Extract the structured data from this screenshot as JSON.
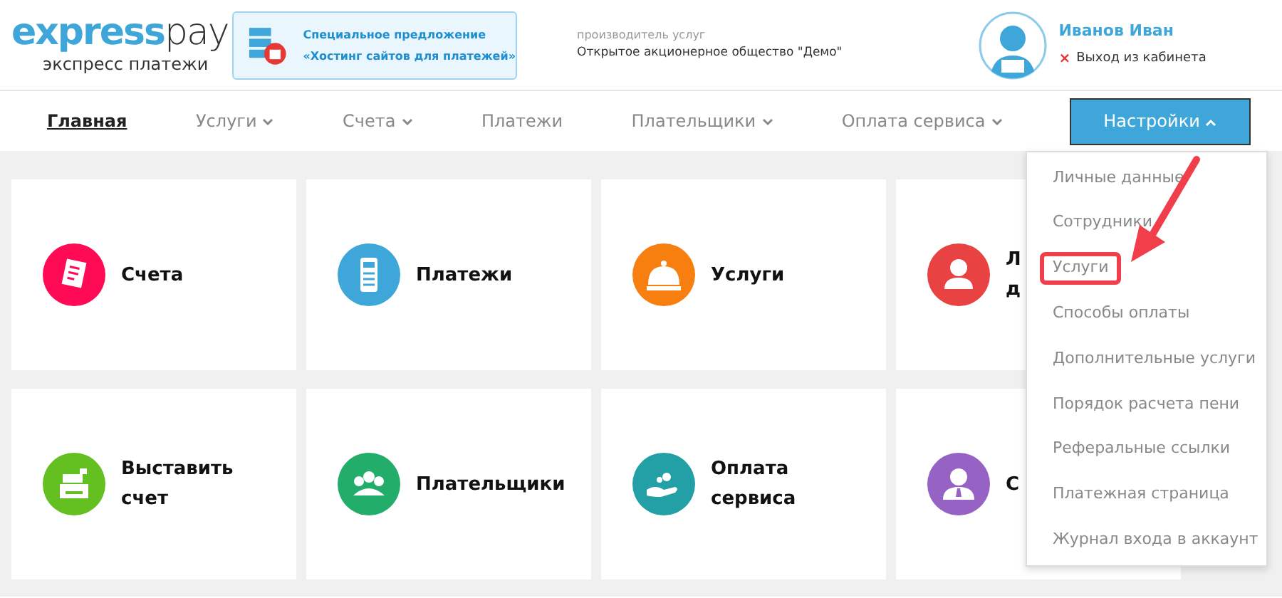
{
  "logo": {
    "name_bold": "express",
    "name_light": "pay",
    "tagline": "экспресс платежи"
  },
  "promo": {
    "lines": [
      "Специальное предложение",
      "«Хостинг сайтов для платежей»"
    ]
  },
  "provider": {
    "label": "производитель услуг",
    "value": "Открытое акционерное общество \"Демо\""
  },
  "user": {
    "name": "Иванов Иван",
    "logout_mark": "×",
    "logout": "Выход из кабинета"
  },
  "nav": [
    {
      "label": "Главная",
      "has_menu": false,
      "selected": true,
      "expanded": false
    },
    {
      "label": "Услуги",
      "has_menu": true,
      "selected": false,
      "expanded": false
    },
    {
      "label": "Счета",
      "has_menu": true,
      "selected": false,
      "expanded": false
    },
    {
      "label": "Платежи",
      "has_menu": false,
      "selected": false,
      "expanded": false
    },
    {
      "label": "Плательщики",
      "has_menu": true,
      "selected": false,
      "expanded": false
    },
    {
      "label": "Оплата сервиса",
      "has_menu": true,
      "selected": false,
      "expanded": false
    },
    {
      "label": "Настройки",
      "has_menu": true,
      "selected": false,
      "expanded": true
    }
  ],
  "tiles": [
    {
      "lines": [
        "Счета"
      ],
      "kind": "invoice",
      "color": "#ff0a54"
    },
    {
      "lines": [
        "Платежи"
      ],
      "kind": "terminal",
      "color": "#3ea6d8"
    },
    {
      "lines": [
        "Услуги"
      ],
      "kind": "bell",
      "color": "#f77f0f"
    },
    {
      "lines": [
        "Л",
        "д"
      ],
      "kind": "person",
      "color": "#e94242"
    },
    {
      "lines": [
        "Выставить",
        "счет"
      ],
      "kind": "register",
      "color": "#64c021"
    },
    {
      "lines": [
        "Плательщики"
      ],
      "kind": "group",
      "color": "#22ad6a"
    },
    {
      "lines": [
        "Оплата",
        "сервиса"
      ],
      "kind": "hand",
      "color": "#23a0a6"
    },
    {
      "lines": [
        "С"
      ],
      "kind": "manager",
      "color": "#9662c4"
    }
  ],
  "menu": [
    {
      "label": "Личные данные",
      "highlighted": false
    },
    {
      "label": "Сотрудники",
      "highlighted": false
    },
    {
      "label": "Услуги",
      "highlighted": true
    },
    {
      "label": "Способы оплаты",
      "highlighted": false
    },
    {
      "label": "Дополнительные услуги",
      "highlighted": false
    },
    {
      "label": "Порядок расчета пени",
      "highlighted": false
    },
    {
      "label": "Реферальные ссылки",
      "highlighted": false
    },
    {
      "label": "Платежная страница",
      "highlighted": false
    },
    {
      "label": "Журнал входа в аккаунт",
      "highlighted": false
    }
  ]
}
